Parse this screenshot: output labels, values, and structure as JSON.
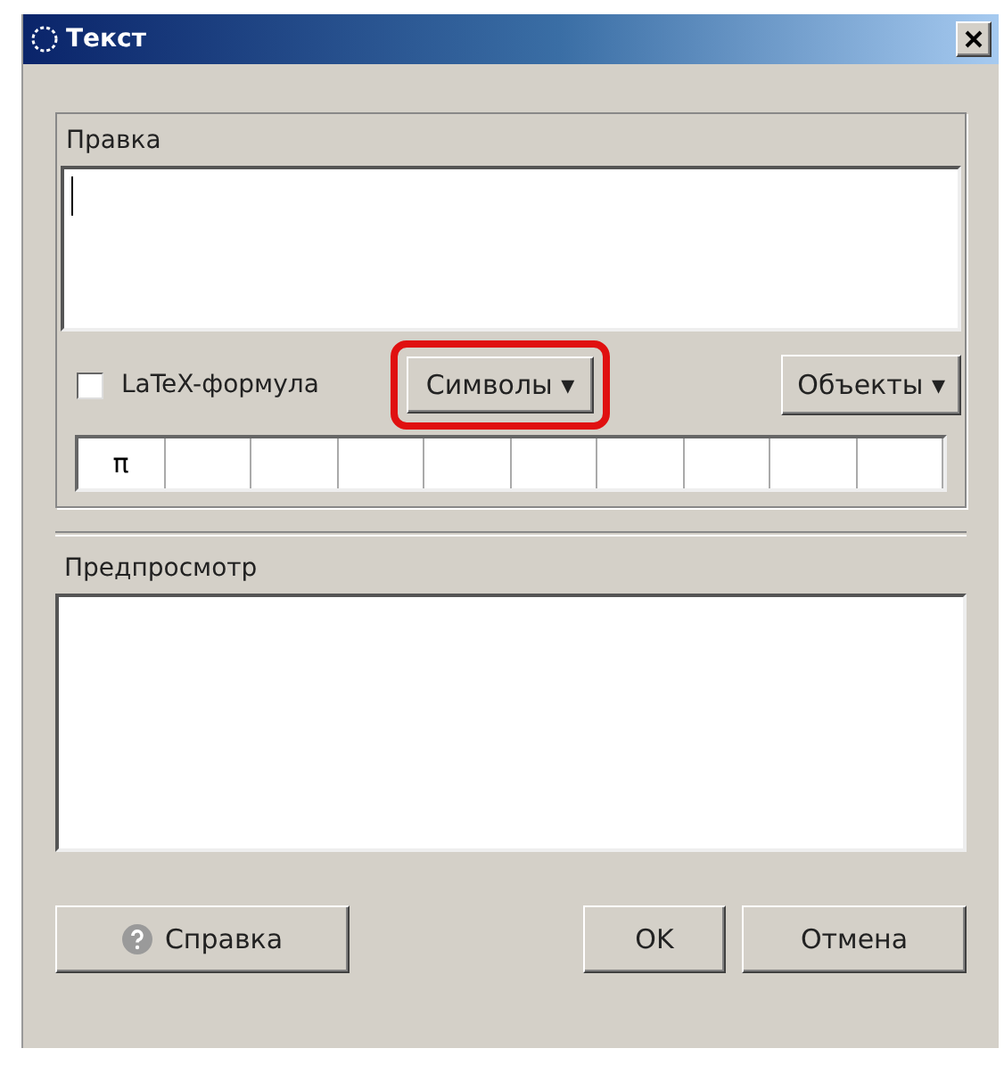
{
  "window": {
    "title": "Текст"
  },
  "edit": {
    "label": "Правка",
    "latex": {
      "label": "LaTeX-формула",
      "checked": false
    },
    "symbols_button": {
      "label": "Символы ▾",
      "highlighted": true
    },
    "objects_button": {
      "label": "Объекты ▾"
    },
    "symbols": [
      "π"
    ]
  },
  "preview": {
    "label": "Предпросмотр"
  },
  "buttons": [
    {
      "kind": "help",
      "label": "Справка"
    },
    {
      "kind": "ok",
      "label": "OK"
    },
    {
      "kind": "cancel",
      "label": "Отмена"
    }
  ]
}
